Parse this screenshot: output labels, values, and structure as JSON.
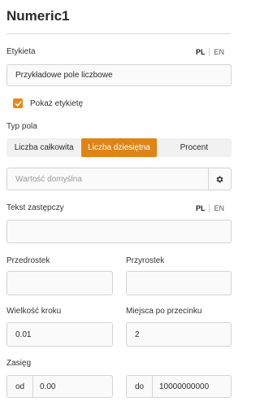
{
  "title": "Numeric1",
  "label_section": {
    "label": "Etykieta",
    "lang_pl": "PL",
    "lang_en": "EN",
    "value": "Przykładowe pole liczbowe"
  },
  "show_label": {
    "label": "Pokaż etykietę",
    "checked": true
  },
  "field_type": {
    "label": "Typ pola",
    "options": [
      "Liczba całkowita",
      "Liczba dziesiętna",
      "Procent"
    ],
    "selected": "Liczba dziesiętna"
  },
  "default_value": {
    "placeholder": "Wartość domyślna",
    "icon": "gear-icon"
  },
  "placeholder_text": {
    "label": "Tekst zastępczy",
    "lang_pl": "PL",
    "lang_en": "EN",
    "value": ""
  },
  "prefix": {
    "label": "Przedrostek",
    "value": ""
  },
  "suffix": {
    "label": "Przyrostek",
    "value": ""
  },
  "step": {
    "label": "Wielkość kroku",
    "value": "0.01"
  },
  "decimals": {
    "label": "Miejsca po przecinku",
    "value": "2"
  },
  "range": {
    "label": "Zasięg",
    "from_label": "od",
    "from_value": "0.00",
    "to_label": "do",
    "to_value": "10000000000"
  },
  "colors": {
    "accent": "#de8514",
    "border": "#d4d4d4"
  }
}
